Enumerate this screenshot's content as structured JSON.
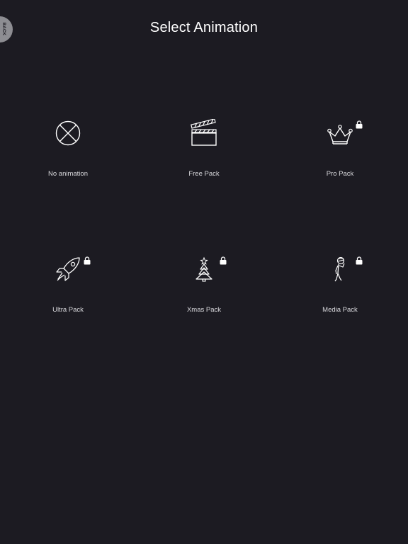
{
  "header": {
    "title": "Select Animation",
    "back_label": "BACK"
  },
  "packs": [
    {
      "label": "No animation",
      "icon": "no-animation-icon",
      "locked": false
    },
    {
      "label": "Free Pack",
      "icon": "clapperboard-icon",
      "locked": false
    },
    {
      "label": "Pro Pack",
      "icon": "crown-icon",
      "locked": true
    },
    {
      "label": "Ultra Pack",
      "icon": "rocket-icon",
      "locked": true
    },
    {
      "label": "Xmas Pack",
      "icon": "christmas-tree-icon",
      "locked": true
    },
    {
      "label": "Media Pack",
      "icon": "stick-figure-icon",
      "locked": true
    }
  ],
  "colors": {
    "background": "#1c1b22",
    "back_button": "#8d8d92",
    "text": "#ffffff",
    "label_text": "#d8d8dc"
  }
}
